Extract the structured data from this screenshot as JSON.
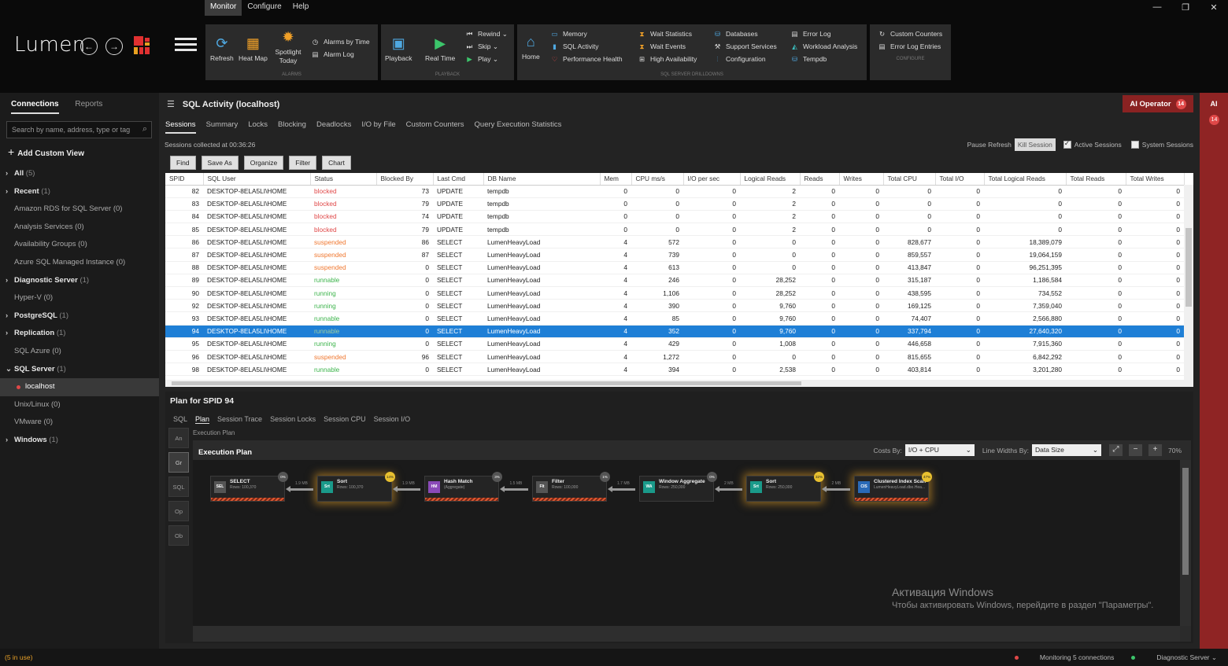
{
  "app": {
    "brand": "Lumen"
  },
  "menu": [
    "Monitor",
    "Configure",
    "Help"
  ],
  "ribbon": {
    "alarms": {
      "caption": "ALARMS",
      "refresh": "Refresh",
      "heatmap": "Heat Map",
      "spotlight": "Spotlight Today",
      "alarms_by_time": "Alarms by Time",
      "alarm_log": "Alarm Log"
    },
    "playback": {
      "caption": "PLAYBACK",
      "playback": "Playback",
      "real_time": "Real Time",
      "rewind": "Rewind",
      "skip": "Skip",
      "play": "Play"
    },
    "drill": {
      "caption": "SQL SERVER DRILLDOWNS",
      "home": "Home",
      "memory": "Memory",
      "sql_activity": "SQL Activity",
      "performance_health": "Performance Health",
      "wait_statistics": "Wait Statistics",
      "wait_events": "Wait Events",
      "high_availability": "High Availability",
      "databases": "Databases",
      "support_services": "Support Services",
      "configuration": "Configuration",
      "error_log": "Error Log",
      "workload_analysis": "Workload Analysis",
      "tempdb": "Tempdb"
    },
    "configure": {
      "caption": "CONFIGURE",
      "custom_counters": "Custom Counters",
      "error_log_entries": "Error Log Entries"
    }
  },
  "left": {
    "tabs": [
      "Connections",
      "Reports"
    ],
    "search_placeholder": "Search by name, address, type or tag",
    "add_view": "Add Custom View",
    "tree": [
      {
        "label": "All",
        "count": "(5)",
        "bold": true,
        "arrow": true
      },
      {
        "label": "Recent",
        "count": "(1)",
        "bold": true,
        "arrow": true
      },
      {
        "label": "Amazon RDS for SQL Server (0)",
        "count": "",
        "bold": false,
        "arrow": false
      },
      {
        "label": "Analysis Services (0)",
        "count": "",
        "bold": false,
        "arrow": false
      },
      {
        "label": "Availability Groups (0)",
        "count": "",
        "bold": false,
        "arrow": false
      },
      {
        "label": "Azure SQL Managed Instance (0)",
        "count": "",
        "bold": false,
        "arrow": false
      },
      {
        "label": "Diagnostic Server",
        "count": "(1)",
        "bold": true,
        "arrow": true
      },
      {
        "label": "Hyper-V (0)",
        "count": "",
        "bold": false,
        "arrow": false
      },
      {
        "label": "PostgreSQL",
        "count": "(1)",
        "bold": true,
        "arrow": true
      },
      {
        "label": "Replication",
        "count": "(1)",
        "bold": true,
        "arrow": true
      },
      {
        "label": "SQL Azure (0)",
        "count": "",
        "bold": false,
        "arrow": false
      },
      {
        "label": "SQL Server",
        "count": "(1)",
        "bold": true,
        "arrow": true,
        "open": true
      },
      {
        "label": "localhost",
        "count": "",
        "bold": false,
        "arrow": false,
        "selected": true
      },
      {
        "label": "Unix/Linux (0)",
        "count": "",
        "bold": false,
        "arrow": false
      },
      {
        "label": "VMware (0)",
        "count": "",
        "bold": false,
        "arrow": false
      },
      {
        "label": "Windows",
        "count": "(1)",
        "bold": true,
        "arrow": true
      }
    ]
  },
  "main": {
    "title": "SQL Activity (localhost)",
    "ai_operator": "AI Operator",
    "ai_count": "14",
    "tabs": [
      "Sessions",
      "Summary",
      "Locks",
      "Blocking",
      "Deadlocks",
      "I/O by File",
      "Custom Counters",
      "Query Execution Statistics"
    ],
    "collected": "Sessions collected at 00:36:26",
    "pause_refresh": "Pause Refresh",
    "kill_session": "Kill Session",
    "active_sessions": "Active Sessions",
    "system_sessions": "System Sessions",
    "toolbar": [
      "Find",
      "Save As",
      "Organize",
      "Filter",
      "Chart"
    ],
    "columns": [
      "SPID",
      "SQL User",
      "Status",
      "Blocked By",
      "Last Cmd",
      "DB Name",
      "Mem",
      "CPU ms/s",
      "I/O per sec",
      "Logical Reads",
      "Reads",
      "Writes",
      "Total CPU",
      "Total I/O",
      "Total Logical Reads",
      "Total Reads",
      "Total Writes"
    ],
    "rows": [
      [
        "82",
        "DESKTOP-8ELA5LI\\HOME",
        "blocked",
        "73",
        "UPDATE",
        "tempdb",
        "0",
        "0",
        "0",
        "2",
        "0",
        "0",
        "0",
        "0",
        "0",
        "0",
        "0"
      ],
      [
        "83",
        "DESKTOP-8ELA5LI\\HOME",
        "blocked",
        "79",
        "UPDATE",
        "tempdb",
        "0",
        "0",
        "0",
        "2",
        "0",
        "0",
        "0",
        "0",
        "0",
        "0",
        "0"
      ],
      [
        "84",
        "DESKTOP-8ELA5LI\\HOME",
        "blocked",
        "74",
        "UPDATE",
        "tempdb",
        "0",
        "0",
        "0",
        "2",
        "0",
        "0",
        "0",
        "0",
        "0",
        "0",
        "0"
      ],
      [
        "85",
        "DESKTOP-8ELA5LI\\HOME",
        "blocked",
        "79",
        "UPDATE",
        "tempdb",
        "0",
        "0",
        "0",
        "2",
        "0",
        "0",
        "0",
        "0",
        "0",
        "0",
        "0"
      ],
      [
        "86",
        "DESKTOP-8ELA5LI\\HOME",
        "suspended",
        "86",
        "SELECT",
        "LumenHeavyLoad",
        "4",
        "572",
        "0",
        "0",
        "0",
        "0",
        "828,677",
        "0",
        "18,389,079",
        "0",
        "0"
      ],
      [
        "87",
        "DESKTOP-8ELA5LI\\HOME",
        "suspended",
        "87",
        "SELECT",
        "LumenHeavyLoad",
        "4",
        "739",
        "0",
        "0",
        "0",
        "0",
        "859,557",
        "0",
        "19,064,159",
        "0",
        "0"
      ],
      [
        "88",
        "DESKTOP-8ELA5LI\\HOME",
        "suspended",
        "0",
        "SELECT",
        "LumenHeavyLoad",
        "4",
        "613",
        "0",
        "0",
        "0",
        "0",
        "413,847",
        "0",
        "96,251,395",
        "0",
        "0"
      ],
      [
        "89",
        "DESKTOP-8ELA5LI\\HOME",
        "runnable",
        "0",
        "SELECT",
        "LumenHeavyLoad",
        "4",
        "246",
        "0",
        "28,252",
        "0",
        "0",
        "315,187",
        "0",
        "1,186,584",
        "0",
        "0"
      ],
      [
        "90",
        "DESKTOP-8ELA5LI\\HOME",
        "running",
        "0",
        "SELECT",
        "LumenHeavyLoad",
        "4",
        "1,106",
        "0",
        "28,252",
        "0",
        "0",
        "438,595",
        "0",
        "734,552",
        "0",
        "0"
      ],
      [
        "92",
        "DESKTOP-8ELA5LI\\HOME",
        "running",
        "0",
        "SELECT",
        "LumenHeavyLoad",
        "4",
        "390",
        "0",
        "9,760",
        "0",
        "0",
        "169,125",
        "0",
        "7,359,040",
        "0",
        "0"
      ],
      [
        "93",
        "DESKTOP-8ELA5LI\\HOME",
        "runnable",
        "0",
        "SELECT",
        "LumenHeavyLoad",
        "4",
        "85",
        "0",
        "9,760",
        "0",
        "0",
        "74,407",
        "0",
        "2,566,880",
        "0",
        "0"
      ],
      [
        "94",
        "DESKTOP-8ELA5LI\\HOME",
        "runnable",
        "0",
        "SELECT",
        "LumenHeavyLoad",
        "4",
        "352",
        "0",
        "9,760",
        "0",
        "0",
        "337,794",
        "0",
        "27,640,320",
        "0",
        "0"
      ],
      [
        "95",
        "DESKTOP-8ELA5LI\\HOME",
        "running",
        "0",
        "SELECT",
        "LumenHeavyLoad",
        "4",
        "429",
        "0",
        "1,008",
        "0",
        "0",
        "446,658",
        "0",
        "7,915,360",
        "0",
        "0"
      ],
      [
        "96",
        "DESKTOP-8ELA5LI\\HOME",
        "suspended",
        "96",
        "SELECT",
        "LumenHeavyLoad",
        "4",
        "1,272",
        "0",
        "0",
        "0",
        "0",
        "815,655",
        "0",
        "6,842,292",
        "0",
        "0"
      ],
      [
        "98",
        "DESKTOP-8ELA5LI\\HOME",
        "runnable",
        "0",
        "SELECT",
        "LumenHeavyLoad",
        "4",
        "394",
        "0",
        "2,538",
        "0",
        "0",
        "403,814",
        "0",
        "3,201,280",
        "0",
        "0"
      ]
    ],
    "selected_spid": "94"
  },
  "plan": {
    "title": "Plan for SPID 94",
    "tabs": [
      "SQL",
      "Plan",
      "Session Trace",
      "Session Locks",
      "Session CPU",
      "Session I/O"
    ],
    "side_buttons": [
      "An",
      "Gr",
      "SQL",
      "Op",
      "Ob"
    ],
    "caption": "Execution Plan",
    "heading": "Execution Plan",
    "costs_by_label": "Costs By:",
    "costs_by_value": "I/O + CPU",
    "line_widths_label": "Line Widths By:",
    "line_widths_value": "Data Size",
    "zoom": "70%",
    "operators": [
      {
        "abbr": "SEL",
        "name": "SELECT",
        "sub": "Rows: 100,370",
        "pct": "0%",
        "color": "#555555",
        "glow": false,
        "hatch": true
      },
      {
        "abbr": "Srt",
        "name": "Sort",
        "sub": "Rows: 100,370",
        "pct": "14%",
        "color": "#1a9a8a",
        "glow": true,
        "hatch": false
      },
      {
        "abbr": "HM",
        "name": "Hash Match",
        "sub": "(Aggregate)",
        "pct": "3%",
        "color": "#8a4ab8",
        "glow": false,
        "hatch": true
      },
      {
        "abbr": "Flt",
        "name": "Filter",
        "sub": "Rows: 100,000",
        "pct": "1%",
        "color": "#555555",
        "glow": false,
        "hatch": true
      },
      {
        "abbr": "WA",
        "name": "Window Aggregate",
        "sub": "Rows: 250,000",
        "pct": "0%",
        "color": "#1a9a8a",
        "glow": false,
        "hatch": false
      },
      {
        "abbr": "Srt",
        "name": "Sort",
        "sub": "Rows: 250,000",
        "pct": "32%",
        "color": "#1a9a8a",
        "glow": true,
        "hatch": false
      },
      {
        "abbr": "CIS",
        "name": "Clustered Index Scan",
        "sub": "LumenHeavyLoad.dbo.Hea...",
        "pct": "47%",
        "color": "#2a6ab8",
        "glow": true,
        "hatch": true
      }
    ],
    "arrows": [
      "1.9 MB",
      "1.9 MB",
      "1.5 MB",
      "1.7 MB",
      "2 MB",
      "2 MB"
    ],
    "watermark_title": "Активация Windows",
    "watermark_sub": "Чтобы активировать Windows, перейдите в раздел \"Параметры\"."
  },
  "right_panel": {
    "label": "AI",
    "count": "14"
  },
  "status": {
    "in_use": "(5 in use)",
    "monitoring": "Monitoring 5 connections",
    "diag": "Diagnostic Server"
  }
}
